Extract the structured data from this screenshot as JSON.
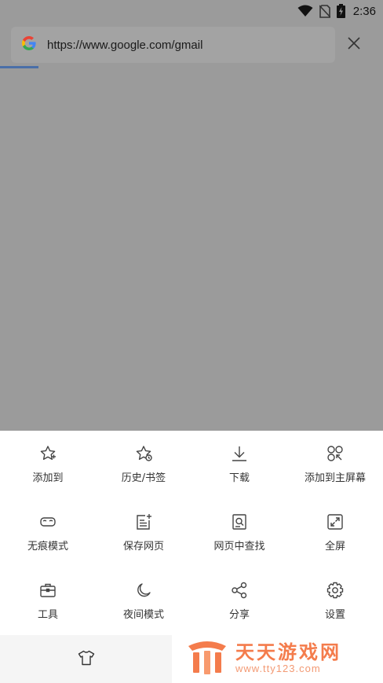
{
  "status_bar": {
    "time": "2:36",
    "icons": [
      "wifi-icon",
      "no-sim-icon",
      "battery-charging-icon"
    ]
  },
  "browser": {
    "url": "https://www.google.com/gmail",
    "site_icon": "google-icon",
    "close_icon": "close-icon",
    "load_progress": 0.1
  },
  "menu": {
    "items": [
      {
        "label": "添加到",
        "icon": "star-add-icon"
      },
      {
        "label": "历史/书签",
        "icon": "star-history-icon"
      },
      {
        "label": "下载",
        "icon": "download-icon"
      },
      {
        "label": "添加到主屏幕",
        "icon": "home-screen-icon"
      },
      {
        "label": "无痕模式",
        "icon": "incognito-mask-icon"
      },
      {
        "label": "保存网页",
        "icon": "save-page-icon"
      },
      {
        "label": "网页中查找",
        "icon": "find-in-page-icon"
      },
      {
        "label": "全屏",
        "icon": "fullscreen-icon"
      },
      {
        "label": "工具",
        "icon": "toolbox-icon"
      },
      {
        "label": "夜间模式",
        "icon": "moon-icon"
      },
      {
        "label": "分享",
        "icon": "share-icon"
      },
      {
        "label": "设置",
        "icon": "gear-icon"
      }
    ]
  },
  "bottom_bar": {
    "theme_icon": "tshirt-icon"
  },
  "watermark": {
    "title": "天天游戏网",
    "url": "www.tty123.com"
  },
  "colors": {
    "overlay": "#9b9b9b",
    "progress": "#4a6fa8",
    "watermark": "#f47c4c"
  }
}
